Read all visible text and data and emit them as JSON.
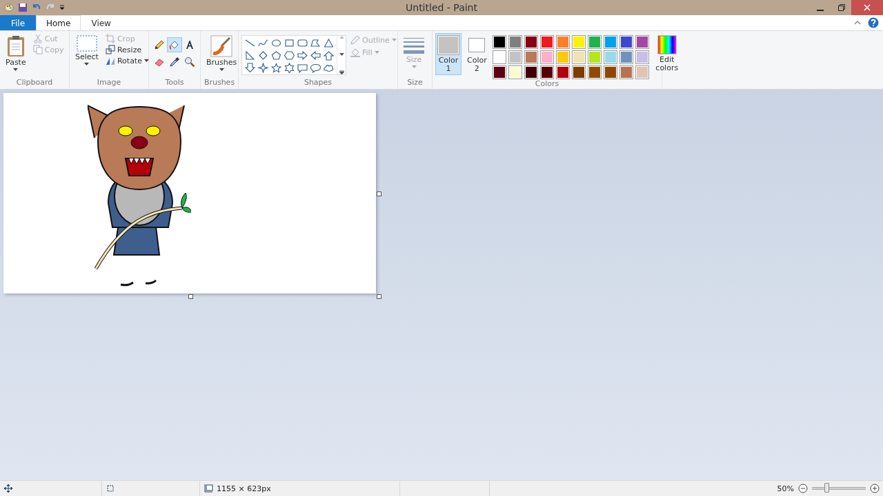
{
  "window": {
    "title": "Untitled - Paint"
  },
  "tabs": [
    {
      "label": "File",
      "kind": "file",
      "selected": false
    },
    {
      "label": "Home",
      "kind": "tab",
      "selected": true
    },
    {
      "label": "View",
      "kind": "tab",
      "selected": false
    }
  ],
  "clipboard": {
    "label": "Clipboard",
    "paste": "Paste",
    "cut": {
      "label": "Cut",
      "disabled": true
    },
    "copy": {
      "label": "Copy",
      "disabled": true
    }
  },
  "image": {
    "label": "Image",
    "select": "Select",
    "crop": {
      "label": "Crop",
      "disabled": true
    },
    "resize": {
      "label": "Resize",
      "disabled": false
    },
    "rotate": {
      "label": "Rotate",
      "disabled": false
    }
  },
  "tools": {
    "label": "Tools",
    "items": [
      {
        "kind": "pencil",
        "selected": false
      },
      {
        "kind": "fill",
        "selected": true
      },
      {
        "kind": "text",
        "selected": false
      },
      {
        "kind": "eraser",
        "selected": false
      },
      {
        "kind": "picker",
        "selected": false
      },
      {
        "kind": "magnifier",
        "selected": false
      }
    ]
  },
  "brushes": {
    "label": "Brushes",
    "group_label": "Brushes"
  },
  "shapes": {
    "label": "Shapes",
    "outline": {
      "label": "Outline",
      "disabled": true
    },
    "fill": {
      "label": "Fill",
      "disabled": true
    }
  },
  "size": {
    "label": "Size",
    "group_label": "Size",
    "disabled": true
  },
  "colors": {
    "label": "Colors",
    "color1": {
      "label": "Color 1",
      "color": "#c3c3c3",
      "selected": true
    },
    "color2": {
      "label": "Color 2",
      "color": "#ffffff",
      "selected": false
    },
    "edit": "Edit colors",
    "palette": [
      {
        "color": "#000000"
      },
      {
        "color": "#7f7f7f"
      },
      {
        "color": "#880015"
      },
      {
        "color": "#ed1c24"
      },
      {
        "color": "#ff7f27"
      },
      {
        "color": "#fff200"
      },
      {
        "color": "#22b14c"
      },
      {
        "color": "#00a2e8"
      },
      {
        "color": "#3f48cc"
      },
      {
        "color": "#a349a4"
      },
      {
        "color": "#ffffff"
      },
      {
        "color": "#c3c3c3"
      },
      {
        "color": "#b97a57"
      },
      {
        "color": "#ffaec9"
      },
      {
        "color": "#ffc90e"
      },
      {
        "color": "#efe4b0"
      },
      {
        "color": "#b5e61d"
      },
      {
        "color": "#99d9ea"
      },
      {
        "color": "#7092be"
      },
      {
        "color": "#c8bfe7"
      },
      {
        "color": "#5c0011"
      },
      {
        "color": "#fffbd0"
      },
      {
        "color": "#3e0005"
      },
      {
        "color": "#560006"
      },
      {
        "color": "#b3000c"
      },
      {
        "color": "#7a3e00"
      },
      {
        "color": "#914a00"
      },
      {
        "color": "#8f4700"
      },
      {
        "color": "#b5734f"
      },
      {
        "color": "#e1c4b6"
      }
    ]
  },
  "status_bar": {
    "image_size": "1155 × 623px",
    "zoom": "50%",
    "zoom_level": {
      "level": 0.25
    }
  }
}
